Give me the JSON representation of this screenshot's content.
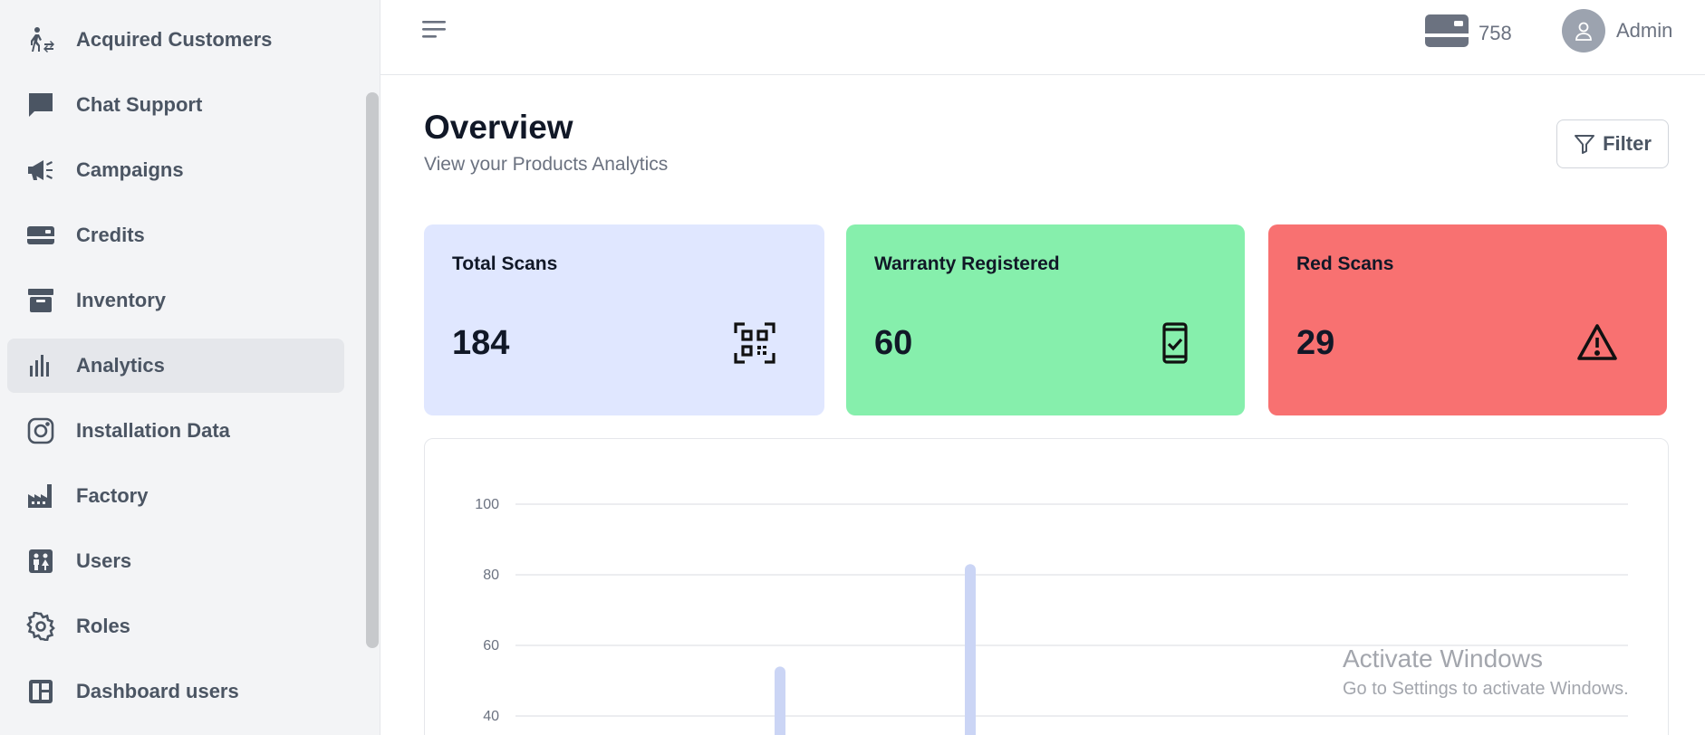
{
  "sidebar": {
    "items": [
      {
        "label": "Acquired Customers",
        "icon": "person-transfer-icon",
        "active": false
      },
      {
        "label": "Chat Support",
        "icon": "chat-bubble-icon",
        "active": false
      },
      {
        "label": "Campaigns",
        "icon": "megaphone-icon",
        "active": false
      },
      {
        "label": "Credits",
        "icon": "credit-card-icon",
        "active": false
      },
      {
        "label": "Inventory",
        "icon": "archive-box-icon",
        "active": false
      },
      {
        "label": "Analytics",
        "icon": "bar-chart-icon",
        "active": true
      },
      {
        "label": "Installation Data",
        "icon": "instagram-icon",
        "active": false
      },
      {
        "label": "Factory",
        "icon": "factory-icon",
        "active": false
      },
      {
        "label": "Users",
        "icon": "users-icon",
        "active": false
      },
      {
        "label": "Roles",
        "icon": "gear-icon",
        "active": false
      },
      {
        "label": "Dashboard users",
        "icon": "dashboard-icon",
        "active": false
      }
    ]
  },
  "header": {
    "menu_icon": "hamburger-menu-icon",
    "credits": "758",
    "credit_icon": "credit-card-icon",
    "user_name": "Admin",
    "avatar_icon": "user-icon"
  },
  "page": {
    "title": "Overview",
    "subtitle": "View your Products Analytics",
    "filter_label": "Filter"
  },
  "cards": [
    {
      "title": "Total Scans",
      "value": "184",
      "bg": "#e0e7ff",
      "icon": "qr-code-icon"
    },
    {
      "title": "Warranty Registered",
      "value": "60",
      "bg": "#86efac",
      "icon": "mobile-check-icon"
    },
    {
      "title": "Red Scans",
      "value": "29",
      "bg": "#f87171",
      "icon": "warning-triangle-icon"
    }
  ],
  "chart_data": {
    "type": "bar",
    "yticks": [
      100,
      80,
      60,
      40
    ],
    "bar_color": "#cbd5f5",
    "grid": true,
    "visible_bars": [
      {
        "value": 54
      },
      {
        "value": 83
      }
    ]
  },
  "watermark": {
    "line1": "Activate Windows",
    "line2": "Go to Settings to activate Windows."
  }
}
